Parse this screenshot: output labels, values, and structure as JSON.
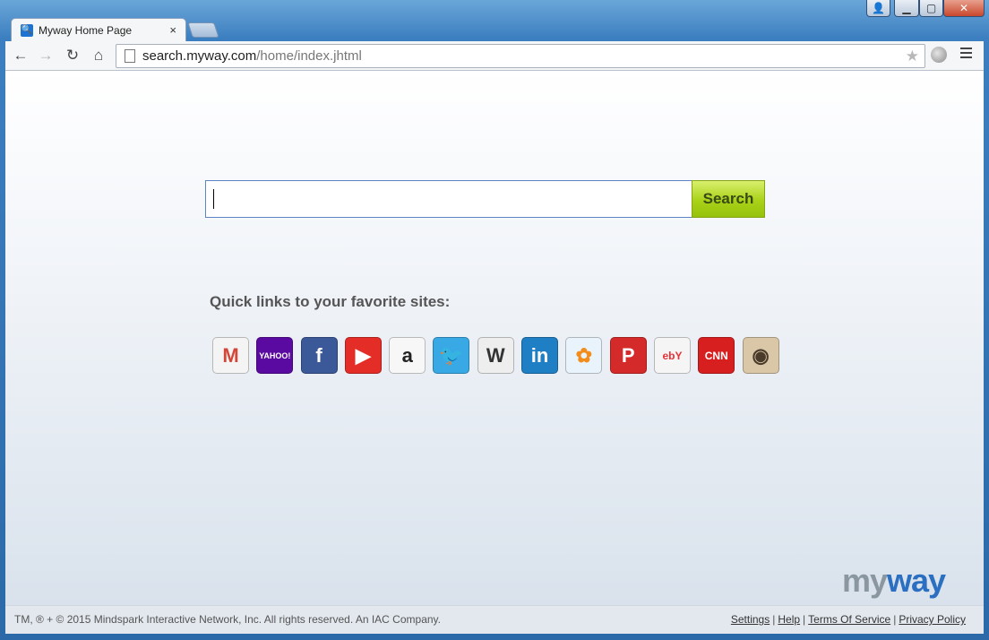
{
  "browser": {
    "tab_title": "Myway Home Page",
    "tab_close": "×",
    "url_host": "search.myway.com",
    "url_path": "/home/index.jhtml"
  },
  "search": {
    "value": "",
    "button_label": "Search"
  },
  "quick_links": {
    "title": "Quick links to your favorite sites:",
    "items": [
      {
        "name": "gmail",
        "glyph": "M",
        "bg": "#f4f4f4",
        "fg": "#d44638"
      },
      {
        "name": "yahoo",
        "glyph": "YAHOO!",
        "bg": "#5a0aa0",
        "fg": "#ffffff"
      },
      {
        "name": "facebook",
        "glyph": "f",
        "bg": "#3b5998",
        "fg": "#ffffff"
      },
      {
        "name": "youtube",
        "glyph": "▶",
        "bg": "#e52d27",
        "fg": "#ffffff"
      },
      {
        "name": "amazon",
        "glyph": "a",
        "bg": "#f7f7f7",
        "fg": "#222222"
      },
      {
        "name": "twitter",
        "glyph": "🐦",
        "bg": "#39a9e6",
        "fg": "#ffffff"
      },
      {
        "name": "wikipedia",
        "glyph": "W",
        "bg": "#eeeeee",
        "fg": "#333333"
      },
      {
        "name": "linkedin",
        "glyph": "in",
        "bg": "#1f7fc4",
        "fg": "#ffffff"
      },
      {
        "name": "msn",
        "glyph": "✿",
        "bg": "#e8f3fb",
        "fg": "#f28c1b"
      },
      {
        "name": "pinterest",
        "glyph": "P",
        "bg": "#d42a2a",
        "fg": "#ffffff"
      },
      {
        "name": "ebay",
        "glyph": "ebY",
        "bg": "#f5f5f5",
        "fg": "#e53238"
      },
      {
        "name": "cnn",
        "glyph": "CNN",
        "bg": "#d81f1f",
        "fg": "#ffffff"
      },
      {
        "name": "instagram",
        "glyph": "◉",
        "bg": "#d9c7a7",
        "fg": "#4a3a2a"
      }
    ]
  },
  "brand": {
    "my": "my",
    "way": "way"
  },
  "footer": {
    "copyright": "TM, ® + © 2015 Mindspark Interactive Network, Inc. All rights reserved. An IAC Company.",
    "links": {
      "settings": "Settings",
      "help": "Help",
      "terms": "Terms Of Service",
      "privacy": "Privacy Policy"
    },
    "separator": "|"
  }
}
